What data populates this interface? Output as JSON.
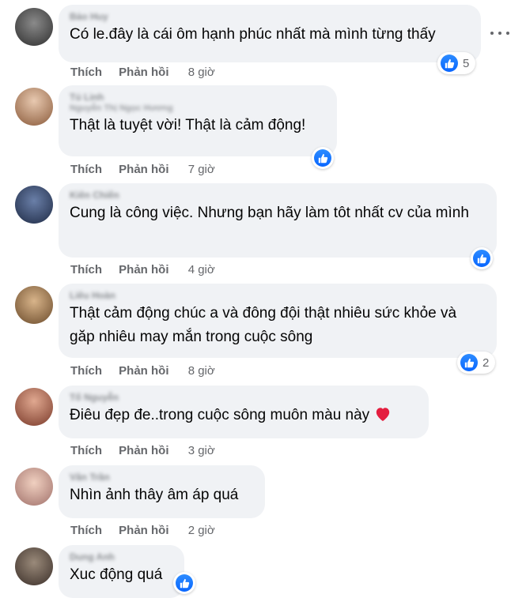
{
  "comments": [
    {
      "author": "Bảo Huy",
      "author_sub": "",
      "text": "Có le.đây là cái ôm hạnh phúc nhất mà mình từng thấy",
      "like_label": "Thích",
      "reply_label": "Phản hồi",
      "time": "8 giờ",
      "reaction_count": "5",
      "avatar_color": "#4a4a4a"
    },
    {
      "author": "Tú Linh",
      "author_sub": "Nguyễn Thị Ngọc Hương",
      "text": "Thật là tuyệt vời! Thật là cảm động!",
      "like_label": "Thích",
      "reply_label": "Phản hồi",
      "time": "7 giờ",
      "reaction_count": "",
      "avatar_color": "#b98a6a"
    },
    {
      "author": "Kiên Chiến",
      "author_sub": "",
      "text": "Cung là công việc. Nhưng bạn hãy làm tôt nhất cv của mình",
      "like_label": "Thích",
      "reply_label": "Phản hồi",
      "time": "4 giờ",
      "reaction_count": "",
      "avatar_color": "#3b4a6b"
    },
    {
      "author": "Liêu Hoàn",
      "author_sub": "",
      "text": "Thật cảm động chúc a và đông đội thật nhiêu sức khỏe và găp nhiêu may mắn trong cuộc sông",
      "like_label": "Thích",
      "reply_label": "Phản hồi",
      "time": "8 giờ",
      "reaction_count": "2",
      "avatar_color": "#9b7a55"
    },
    {
      "author": "Tố Nguyễn",
      "author_sub": "",
      "text": "Điêu đẹp đe..trong cuộc sông muôn màu này",
      "like_label": "Thích",
      "reply_label": "Phản hồi",
      "time": "3 giờ",
      "reaction_count": "",
      "avatar_color": "#8a5a4a"
    },
    {
      "author": "Vân Trần",
      "author_sub": "",
      "text": "Nhìn ảnh thây âm áp quá",
      "like_label": "Thích",
      "reply_label": "Phản hồi",
      "time": "2 giờ",
      "reaction_count": "",
      "avatar_color": "#c79a8a"
    },
    {
      "author": "Dung Anh",
      "author_sub": "",
      "text": "Xuc động quá",
      "like_label": "Thích",
      "reply_label": "Phản hồi",
      "time": "",
      "reaction_count": "",
      "avatar_color": "#6a5a4a"
    }
  ],
  "colors": {
    "bubble": "#f0f2f5",
    "like_blue": "#0866ff",
    "meta_gray": "#65676b",
    "heart": "#e41e3f"
  }
}
